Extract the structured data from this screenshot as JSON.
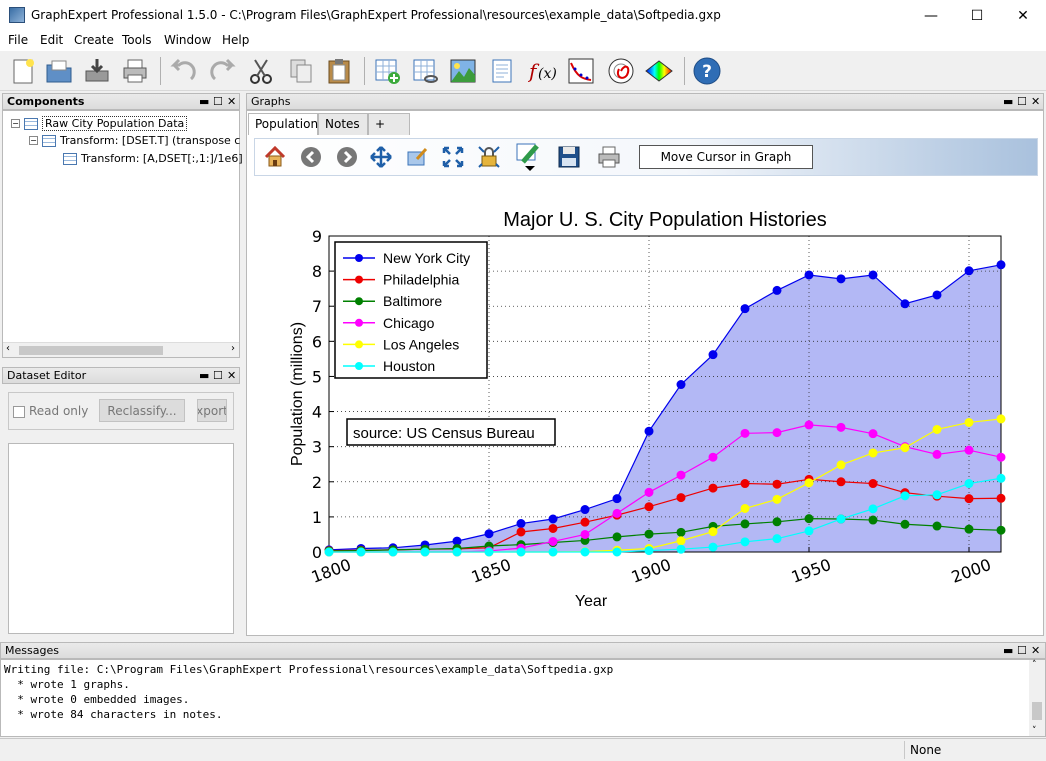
{
  "window": {
    "title": "GraphExpert Professional 1.5.0 - C:\\Program Files\\GraphExpert Professional\\resources\\example_data\\Softpedia.gxp",
    "minimize": "—",
    "maximize": "☐",
    "close": "✕"
  },
  "menu": [
    "File",
    "Edit",
    "Create",
    "Tools",
    "Window",
    "Help"
  ],
  "components": {
    "header": "Components",
    "items": [
      "Raw City Population Data",
      "Transform: [DSET.T] (transpose c",
      "Transform: [A,DSET[:,1:]/1e6]"
    ]
  },
  "dataset_editor": {
    "header": "Dataset Editor",
    "read_only": "Read only",
    "reclassify": "Reclassify...",
    "export": "xport"
  },
  "graphs": {
    "header": "Graphs",
    "tabs": [
      "Population",
      "Notes",
      "+"
    ],
    "status_label": "Move Cursor in Graph"
  },
  "messages": {
    "header": "Messages",
    "lines": [
      "Writing file: C:\\Program Files\\GraphExpert Professional\\resources\\example_data\\Softpedia.gxp",
      "  * wrote 1 graphs.",
      "  * wrote 0 embedded images.",
      "  * wrote 84 characters in notes."
    ]
  },
  "statusbar": {
    "text": "None"
  },
  "chart_data": {
    "type": "line",
    "title": "Major U. S. City Population Histories",
    "xlabel": "Year",
    "ylabel": "Population (millions)",
    "xlim": [
      1800,
      2010
    ],
    "ylim": [
      0,
      9
    ],
    "xticks": [
      1800,
      1850,
      1900,
      1950,
      2000
    ],
    "yticks": [
      0,
      1,
      2,
      3,
      4,
      5,
      6,
      7,
      8,
      9
    ],
    "grid": true,
    "legend": "top-left",
    "annotation": "source: US Census Bureau",
    "x": [
      1800,
      1810,
      1820,
      1830,
      1840,
      1850,
      1860,
      1870,
      1880,
      1890,
      1900,
      1910,
      1920,
      1930,
      1940,
      1950,
      1960,
      1970,
      1980,
      1990,
      2000,
      2010
    ],
    "series": [
      {
        "name": "New York City",
        "color": "#0000ee",
        "fill": "#b3b8f5",
        "values": [
          0.06,
          0.1,
          0.12,
          0.2,
          0.31,
          0.52,
          0.81,
          0.94,
          1.21,
          1.52,
          3.44,
          4.77,
          5.62,
          6.93,
          7.45,
          7.89,
          7.78,
          7.89,
          7.07,
          7.32,
          8.01,
          8.18
        ]
      },
      {
        "name": "Philadelphia",
        "color": "#ee0000",
        "values": [
          0.04,
          0.05,
          0.06,
          0.08,
          0.09,
          0.12,
          0.57,
          0.67,
          0.85,
          1.05,
          1.29,
          1.55,
          1.82,
          1.95,
          1.93,
          2.07,
          2.0,
          1.95,
          1.69,
          1.59,
          1.52,
          1.53
        ]
      },
      {
        "name": "Baltimore",
        "color": "#008000",
        "values": [
          0.03,
          0.04,
          0.06,
          0.08,
          0.1,
          0.17,
          0.21,
          0.27,
          0.33,
          0.43,
          0.51,
          0.56,
          0.73,
          0.8,
          0.86,
          0.95,
          0.94,
          0.91,
          0.79,
          0.74,
          0.65,
          0.62
        ]
      },
      {
        "name": "Chicago",
        "color": "#ff00ff",
        "values": [
          0.0,
          0.0,
          0.0,
          0.0,
          0.0,
          0.03,
          0.11,
          0.3,
          0.5,
          1.1,
          1.7,
          2.19,
          2.7,
          3.38,
          3.4,
          3.62,
          3.55,
          3.37,
          3.0,
          2.78,
          2.9,
          2.7
        ]
      },
      {
        "name": "Los Angeles",
        "color": "#ffff00",
        "values": [
          0.0,
          0.0,
          0.0,
          0.0,
          0.0,
          0.0,
          0.0,
          0.0,
          0.01,
          0.05,
          0.1,
          0.32,
          0.58,
          1.24,
          1.5,
          1.97,
          2.48,
          2.82,
          2.97,
          3.49,
          3.69,
          3.79
        ]
      },
      {
        "name": "Houston",
        "color": "#00ffff",
        "values": [
          0.0,
          0.0,
          0.0,
          0.0,
          0.0,
          0.0,
          0.0,
          0.0,
          0.0,
          0.0,
          0.04,
          0.08,
          0.14,
          0.29,
          0.38,
          0.6,
          0.94,
          1.23,
          1.6,
          1.63,
          1.95,
          2.1
        ]
      }
    ]
  }
}
